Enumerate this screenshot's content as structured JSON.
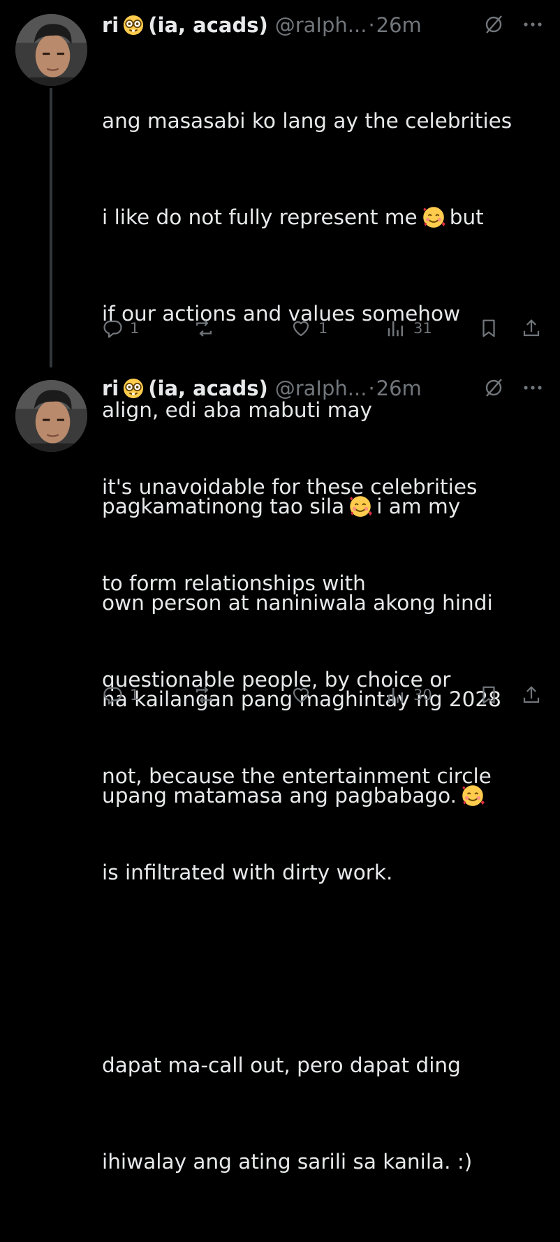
{
  "tweets": [
    {
      "author_name": "ri",
      "author_tag": "(ia, acads)",
      "handle": "@raIph...",
      "separator": "·",
      "time": "26m",
      "lines": [
        "ang masasabi ko lang ay the celebrities",
        "i like do not fully represent me",
        "but",
        "if our actions and values somehow",
        "align, edi aba mabuti may",
        "pagkamatinong tao sila",
        "i am my",
        "own person at naniniwala akong hindi",
        "na kailangan pang maghintay ng 2028",
        "upang matamasa ang pagbabago."
      ],
      "replies": "1",
      "likes": "1",
      "views": "31"
    },
    {
      "author_name": "ri",
      "author_tag": "(ia, acads)",
      "handle": "@raIph...",
      "separator": "·",
      "time": "26m",
      "lines": [
        "it's unavoidable for these celebrities",
        "to form relationships with",
        "questionable people, by choice or",
        "not, because the entertainment circle",
        "is infiltrated with dirty work.",
        "",
        "dapat ma-call out, pero dapat ding",
        "ihiwalay ang ating sarili sa kanila. :)"
      ],
      "replies": "1",
      "likes": "",
      "views": "30"
    }
  ],
  "icons": {
    "name_emoji": "nerd-face-emoji",
    "body_emoji": "smiling-face-with-hearts-emoji",
    "grok": "grok-icon",
    "more": "more-icon",
    "reply": "reply-icon",
    "repost": "repost-icon",
    "like": "like-icon",
    "views": "views-icon",
    "bookmark": "bookmark-icon",
    "share": "share-icon"
  },
  "colors": {
    "background": "#000000",
    "text": "#e7e9ea",
    "muted": "#71767b",
    "thread_line": "#333639"
  }
}
